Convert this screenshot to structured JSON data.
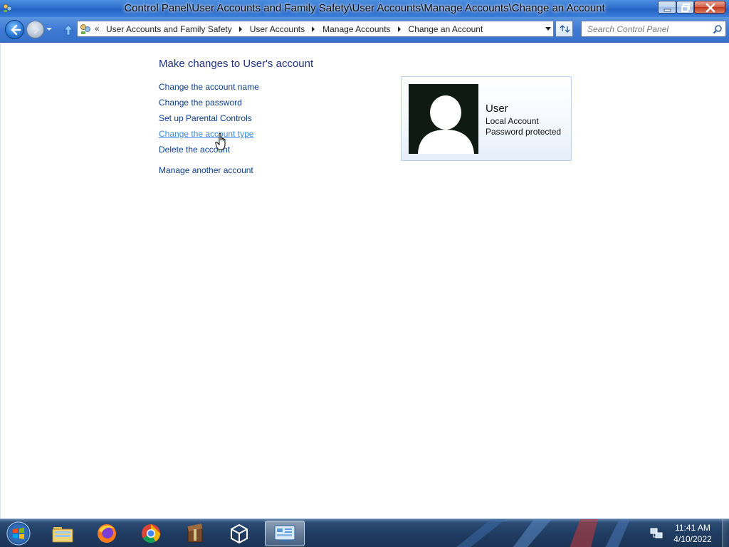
{
  "window": {
    "title": "Control Panel\\User Accounts and Family Safety\\User Accounts\\Manage Accounts\\Change an Account"
  },
  "address": {
    "overflow": "«",
    "crumbs": [
      "User Accounts and Family Safety",
      "User Accounts",
      "Manage Accounts",
      "Change an Account"
    ]
  },
  "search": {
    "placeholder": "Search Control Panel"
  },
  "main": {
    "heading": "Make changes to User's account",
    "links": {
      "change_name": "Change the account name",
      "change_password": "Change the password",
      "parental_controls": "Set up Parental Controls",
      "change_type": "Change the account type",
      "delete_account": "Delete the account",
      "manage_another": "Manage another account"
    }
  },
  "account": {
    "name": "User",
    "type": "Local Account",
    "status": "Password protected"
  },
  "taskbar": {
    "pinned": [
      "windows-explorer",
      "firefox",
      "chrome",
      "archive-manager",
      "virtualbox",
      "control-panel"
    ],
    "active": "control-panel"
  },
  "clock": {
    "time": "11:41 AM",
    "date": "4/10/2022"
  },
  "colors": {
    "link": "#0b3e8f",
    "link_hover": "#3f8bd7",
    "heading": "#1e3287",
    "titlebar": "#2f6fcd"
  }
}
